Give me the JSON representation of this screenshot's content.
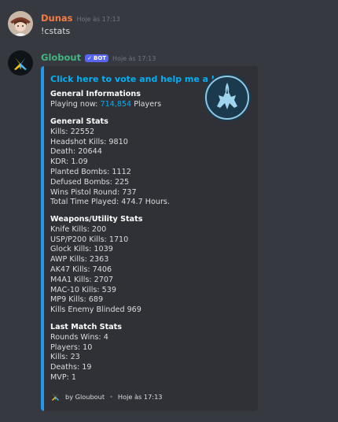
{
  "messages": [
    {
      "author": "Dunas",
      "timestamp": "Hoje às 17:13",
      "text": "!cstats",
      "author_color": "#f47b42"
    },
    {
      "author": "Globout",
      "bot_tag": "BOT",
      "timestamp": "Hoje às 17:13",
      "author_color": "#43b581"
    }
  ],
  "embed": {
    "accent_color": "#2196f3",
    "title": "Click here to vote and help me a lot!",
    "thumbnail_icon": "csgo-logo-icon",
    "general_info": {
      "name": "General Informations",
      "playing_label": "Playing now:",
      "playing_count": "714,854",
      "playing_suffix": "Players"
    },
    "general_stats": {
      "name": "General Stats",
      "lines": [
        "Kills: 22552",
        "Headshot Kills: 9810",
        "Death: 20644",
        "KDR: 1.09",
        "Planted Bombs: 1112",
        "Defused Bombs: 225",
        "Wins Pistol Round: 737",
        "Total Time Played: 474.7 Hours."
      ]
    },
    "weapons_stats": {
      "name": "Weapons/Utility Stats",
      "lines": [
        "Knife Kills: 200",
        "USP/P200 Kills: 1710",
        "Glock Kills: 1039",
        "AWP Kills: 2363",
        "AK47 Kills: 7406",
        "M4A1 Kills: 2707",
        "MAC-10 Kills: 539",
        "MP9 Kills: 689",
        "Kills Enemy Blinded 969"
      ]
    },
    "last_match": {
      "name": "Last Match Stats",
      "lines": [
        "Rounds Wins: 4",
        "Players: 10",
        "Kills: 23",
        "Deaths: 19",
        "MVP: 1"
      ]
    },
    "footer": {
      "text": "by Gloubout",
      "separator": "•",
      "timestamp": "Hoje às 17:13"
    }
  }
}
